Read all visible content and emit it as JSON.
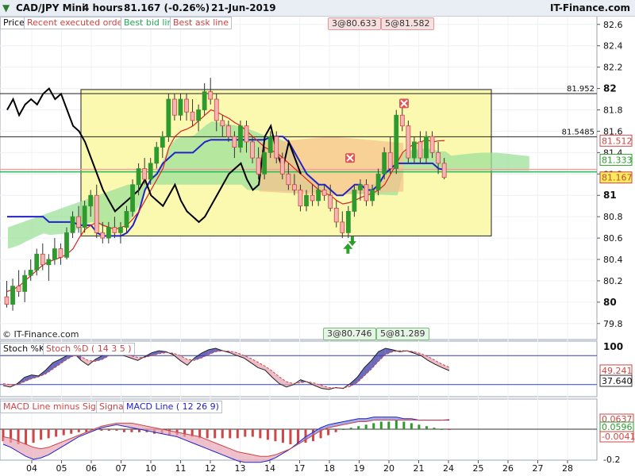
{
  "header": {
    "symbol": "CAD/JPY Mini",
    "timeframe": "4 hours",
    "price_change": "81.167 (-0.26%)",
    "date": "21-Jun-2019",
    "brand": "IT-Finance.com"
  },
  "legend": {
    "price": "Price",
    "recent": "Recent executed orders",
    "bid": "Best bid line",
    "ask": "Best ask line",
    "stoch_k": "Stoch %K",
    "stoch_d": "Stoch %D ( 14 3 5 )",
    "macd_hist": "MACD Line minus Signal",
    "macd_signal": "Signal",
    "macd_line": "MACD Line ( 12 26 9)"
  },
  "orders": {
    "top_a": "3@80.633",
    "top_b": "5@81.582",
    "bot_a": "3@80.746",
    "bot_b": "5@81.289"
  },
  "copyright": "© IT-Finance.com",
  "colors": {
    "up": "#2e9a2e",
    "down": "#d04545",
    "kijun": "#2222cc",
    "tenkan": "#dd2222",
    "chikou": "#000000",
    "cloud_bull": "#9ee09a",
    "cloud_bear": "#f6c38e",
    "rect_fill": "#fbf9b0",
    "bid": "#22bb55",
    "ask": "#f2a0a0"
  },
  "chart_data": [
    {
      "type": "candlestick",
      "title": "CAD/JPY Mini 4 hours",
      "x_tick_labels": [
        "04",
        "05",
        "06",
        "07",
        "10",
        "11",
        "12",
        "13",
        "14",
        "17",
        "18",
        "19",
        "20",
        "21",
        "24",
        "25",
        "26",
        "27",
        "28"
      ],
      "y_ticks": [
        79.8,
        80,
        80.2,
        80.4,
        80.6,
        80.8,
        81,
        81.2,
        81.4,
        81.6,
        81.8,
        82,
        82.2,
        82.4,
        82.6
      ],
      "y_tick_labels": [
        "79.8",
        "80",
        "80.2",
        "80.4",
        "80.6",
        "80.8",
        "81",
        "81.2",
        "81.4",
        "81.6",
        "81.8",
        "82",
        "82.2",
        "82.4",
        "82.6"
      ],
      "ylim": [
        79.65,
        82.68
      ],
      "levels": [
        {
          "label": "81.952",
          "value": 81.952
        },
        {
          "label": "81.5485",
          "value": 81.5485
        }
      ],
      "price_labels": [
        {
          "label": "81.512",
          "value": 81.512,
          "color": "#d04545"
        },
        {
          "label": "81.333",
          "value": 81.333,
          "color": "#2e9a2e"
        },
        {
          "label": "81.167",
          "value": 81.167,
          "color": "#d04545",
          "bg": "#f7ec5a"
        }
      ],
      "ohlc": [
        [
          80.05,
          80.2,
          79.95,
          79.98
        ],
        [
          79.98,
          80.22,
          79.92,
          80.15
        ],
        [
          80.15,
          80.3,
          80.05,
          80.1
        ],
        [
          80.1,
          80.3,
          80.0,
          80.25
        ],
        [
          80.25,
          80.4,
          80.2,
          80.3
        ],
        [
          80.3,
          80.5,
          80.25,
          80.45
        ],
        [
          80.45,
          80.55,
          80.3,
          80.35
        ],
        [
          80.35,
          80.45,
          80.2,
          80.4
        ],
        [
          80.4,
          80.6,
          80.35,
          80.5
        ],
        [
          80.5,
          80.55,
          80.35,
          80.42
        ],
        [
          80.42,
          80.7,
          80.4,
          80.65
        ],
        [
          80.65,
          80.85,
          80.6,
          80.8
        ],
        [
          80.8,
          80.9,
          80.65,
          80.7
        ],
        [
          80.7,
          80.95,
          80.65,
          80.9
        ],
        [
          80.9,
          81.05,
          80.8,
          81.0
        ],
        [
          81.0,
          81.1,
          80.6,
          80.65
        ],
        [
          80.65,
          80.75,
          80.55,
          80.6
        ],
        [
          80.6,
          80.75,
          80.55,
          80.7
        ],
        [
          80.7,
          80.8,
          80.6,
          80.65
        ],
        [
          80.65,
          80.75,
          80.55,
          80.7
        ],
        [
          80.7,
          80.9,
          80.65,
          80.85
        ],
        [
          80.85,
          81.15,
          80.8,
          81.1
        ],
        [
          81.1,
          81.3,
          81.0,
          81.25
        ],
        [
          81.25,
          81.35,
          81.1,
          81.15
        ],
        [
          81.15,
          81.35,
          81.1,
          81.3
        ],
        [
          81.3,
          81.5,
          81.25,
          81.45
        ],
        [
          81.45,
          81.6,
          81.35,
          81.55
        ],
        [
          81.55,
          81.95,
          81.5,
          81.9
        ],
        [
          81.9,
          81.95,
          81.7,
          81.75
        ],
        [
          81.75,
          81.95,
          81.7,
          81.9
        ],
        [
          81.9,
          81.95,
          81.7,
          81.78
        ],
        [
          81.78,
          81.9,
          81.65,
          81.7
        ],
        [
          81.7,
          81.85,
          81.6,
          81.8
        ],
        [
          81.8,
          82.05,
          81.75,
          81.97
        ],
        [
          81.97,
          82.1,
          81.85,
          81.9
        ],
        [
          81.9,
          81.95,
          81.6,
          81.7
        ],
        [
          81.7,
          81.75,
          81.55,
          81.65
        ],
        [
          81.65,
          81.7,
          81.5,
          81.55
        ],
        [
          81.55,
          81.6,
          81.35,
          81.45
        ],
        [
          81.45,
          81.7,
          81.4,
          81.65
        ],
        [
          81.65,
          81.7,
          81.4,
          81.5
        ],
        [
          81.5,
          81.55,
          81.3,
          81.35
        ],
        [
          81.35,
          81.45,
          81.15,
          81.2
        ],
        [
          81.2,
          81.45,
          81.15,
          81.4
        ],
        [
          81.4,
          81.6,
          81.35,
          81.55
        ],
        [
          81.55,
          81.6,
          81.3,
          81.35
        ],
        [
          81.35,
          81.4,
          81.15,
          81.2
        ],
        [
          81.2,
          81.3,
          81.05,
          81.1
        ],
        [
          81.1,
          81.2,
          81.0,
          81.05
        ],
        [
          81.05,
          81.1,
          80.85,
          80.9
        ],
        [
          80.9,
          81.05,
          80.85,
          81.0
        ],
        [
          81.0,
          81.1,
          80.9,
          80.95
        ],
        [
          80.95,
          81.1,
          80.9,
          81.05
        ],
        [
          81.05,
          81.1,
          80.95,
          81.0
        ],
        [
          81.0,
          81.1,
          80.85,
          80.88
        ],
        [
          80.88,
          80.95,
          80.7,
          80.75
        ],
        [
          80.75,
          80.85,
          80.6,
          80.65
        ],
        [
          80.65,
          80.9,
          80.6,
          80.85
        ],
        [
          80.85,
          81.1,
          80.8,
          81.05
        ],
        [
          81.05,
          81.15,
          80.95,
          81.1
        ],
        [
          81.1,
          81.15,
          80.9,
          80.95
        ],
        [
          80.95,
          81.1,
          80.9,
          81.05
        ],
        [
          81.05,
          81.25,
          81.0,
          81.2
        ],
        [
          81.2,
          81.45,
          81.15,
          81.4
        ],
        [
          81.4,
          81.55,
          81.2,
          81.25
        ],
        [
          81.25,
          81.8,
          81.2,
          81.75
        ],
        [
          81.75,
          81.85,
          81.6,
          81.65
        ],
        [
          81.65,
          81.7,
          81.3,
          81.35
        ],
        [
          81.35,
          81.55,
          81.3,
          81.5
        ],
        [
          81.5,
          81.6,
          81.3,
          81.35
        ],
        [
          81.35,
          81.6,
          81.3,
          81.55
        ],
        [
          81.55,
          81.6,
          81.35,
          81.4
        ],
        [
          81.4,
          81.5,
          81.2,
          81.3
        ],
        [
          81.3,
          81.35,
          81.15,
          81.167
        ]
      ],
      "tenkan_sen": [
        80.1,
        80.12,
        80.15,
        80.2,
        80.25,
        80.3,
        80.35,
        80.38,
        80.4,
        80.42,
        80.45,
        80.5,
        80.6,
        80.68,
        80.72,
        80.75,
        80.72,
        80.7,
        80.68,
        80.7,
        80.72,
        80.78,
        80.85,
        80.95,
        81.05,
        81.15,
        81.25,
        81.45,
        81.55,
        81.6,
        81.62,
        81.65,
        81.7,
        81.75,
        81.8,
        81.78,
        81.75,
        81.72,
        81.68,
        81.65,
        81.6,
        81.55,
        81.5,
        81.45,
        81.42,
        81.4,
        81.35,
        81.3,
        81.25,
        81.2,
        81.15,
        81.1,
        81.05,
        81.02,
        81.0,
        80.95,
        80.92,
        80.93,
        80.95,
        80.98,
        81.0,
        81.02,
        81.05,
        81.1,
        81.2,
        81.3,
        81.4,
        81.45,
        81.48,
        81.5,
        81.52,
        81.5,
        81.51,
        81.512
      ],
      "kijun_sen": [
        80.8,
        80.8,
        80.8,
        80.8,
        80.8,
        80.8,
        80.8,
        80.75,
        80.75,
        80.75,
        80.75,
        80.75,
        80.72,
        80.72,
        80.72,
        80.65,
        80.62,
        80.62,
        80.62,
        80.62,
        80.65,
        80.72,
        80.85,
        81.05,
        81.15,
        81.2,
        81.3,
        81.35,
        81.4,
        81.4,
        81.4,
        81.4,
        81.45,
        81.5,
        81.52,
        81.52,
        81.52,
        81.52,
        81.52,
        81.52,
        81.52,
        81.52,
        81.52,
        81.52,
        81.55,
        81.55,
        81.55,
        81.5,
        81.4,
        81.3,
        81.2,
        81.15,
        81.1,
        81.1,
        81.05,
        81.0,
        81.0,
        81.05,
        81.1,
        81.1,
        81.05,
        81.05,
        81.1,
        81.2,
        81.25,
        81.3,
        81.3,
        81.3,
        81.3,
        81.3,
        81.3,
        81.3,
        81.25,
        81.24
      ],
      "chikou_span": [
        81.8,
        81.9,
        81.75,
        81.85,
        81.9,
        81.85,
        81.95,
        82.0,
        81.9,
        81.95,
        81.8,
        81.65,
        81.6,
        81.5,
        81.35,
        81.2,
        81.05,
        80.95,
        80.85,
        80.9,
        80.95,
        81.0,
        81.05,
        81.15,
        81.0,
        80.95,
        80.9,
        81.0,
        81.1,
        80.95,
        80.85,
        80.8,
        80.75,
        80.8,
        80.9,
        81.0,
        81.1,
        81.2,
        81.25,
        81.3,
        81.15,
        81.05,
        81.1,
        81.55,
        81.65,
        81.4,
        81.25,
        81.5,
        81.35,
        81.2
      ]
    },
    {
      "type": "line",
      "title": "Stoch %K / Stoch %D ( 14 3 5 )",
      "y_tick_labels": [
        "100"
      ],
      "ylim": [
        0,
        100
      ],
      "levels": [
        20,
        80
      ],
      "value_labels": [
        "49.241",
        "37.640"
      ],
      "series": [
        {
          "name": "Stoch %K",
          "values": [
            18,
            15,
            22,
            35,
            40,
            38,
            50,
            65,
            72,
            80,
            85,
            70,
            60,
            72,
            80,
            88,
            85,
            80,
            75,
            70,
            78,
            86,
            90,
            88,
            82,
            70,
            60,
            75,
            85,
            92,
            95,
            90,
            86,
            80,
            75,
            65,
            55,
            50,
            35,
            22,
            15,
            20,
            30,
            25,
            18,
            12,
            10,
            14,
            12,
            22,
            35,
            55,
            70,
            88,
            95,
            92,
            88,
            90,
            85,
            80,
            70,
            62,
            55,
            49
          ]
        },
        {
          "name": "Stoch %D ( 14 3 5 )",
          "values": [
            22,
            20,
            20,
            26,
            32,
            36,
            42,
            52,
            62,
            72,
            80,
            78,
            70,
            68,
            72,
            80,
            84,
            83,
            80,
            76,
            76,
            80,
            84,
            86,
            85,
            80,
            72,
            70,
            75,
            82,
            88,
            90,
            89,
            86,
            80,
            74,
            66,
            58,
            48,
            36,
            26,
            22,
            24,
            26,
            23,
            18,
            14,
            13,
            13,
            16,
            24,
            38,
            52,
            68,
            82,
            88,
            90,
            90,
            88,
            84,
            78,
            70,
            62,
            56
          ]
        }
      ]
    },
    {
      "type": "bar",
      "title": "MACD Line ( 12 26 9)",
      "y_tick_labels": [
        "-0.2"
      ],
      "value_labels": [
        "0.0637",
        "0.0596",
        "-0.0041"
      ],
      "series": [
        {
          "name": "MACD Line minus Signal",
          "values": [
            -0.08,
            -0.09,
            -0.1,
            -0.1,
            -0.09,
            -0.07,
            -0.06,
            -0.05,
            -0.04,
            -0.03,
            -0.02,
            -0.02,
            -0.01,
            -0.01,
            -0.01,
            -0.01,
            -0.02,
            -0.02,
            -0.02,
            -0.02,
            -0.03,
            -0.03,
            -0.04,
            -0.04,
            -0.05,
            -0.05,
            -0.06,
            -0.06,
            -0.06,
            -0.06,
            -0.06,
            -0.06,
            -0.05,
            -0.05,
            -0.06,
            -0.07,
            -0.08,
            -0.09,
            -0.1,
            -0.1,
            -0.09,
            -0.08,
            -0.06,
            -0.04,
            -0.02,
            0.0,
            0.01,
            0.02,
            0.03,
            0.04,
            0.05,
            0.05,
            0.06,
            0.05,
            0.04,
            0.03,
            0.02,
            0.01,
            0.0,
            -0.004
          ]
        },
        {
          "name": "Signal",
          "values": [
            -0.05,
            -0.06,
            -0.08,
            -0.1,
            -0.12,
            -0.13,
            -0.12,
            -0.1,
            -0.08,
            -0.06,
            -0.04,
            -0.02,
            0.0,
            0.02,
            0.03,
            0.04,
            0.04,
            0.04,
            0.03,
            0.02,
            0.01,
            0.0,
            -0.01,
            -0.02,
            -0.03,
            -0.04,
            -0.05,
            -0.07,
            -0.09,
            -0.11,
            -0.13,
            -0.15,
            -0.16,
            -0.17,
            -0.18,
            -0.18,
            -0.17,
            -0.15,
            -0.13,
            -0.1,
            -0.07,
            -0.04,
            -0.01,
            0.01,
            0.02,
            0.03,
            0.04,
            0.05,
            0.05,
            0.06,
            0.06,
            0.06,
            0.06,
            0.06,
            0.06,
            0.06,
            0.06,
            0.06,
            0.06,
            0.0637
          ]
        },
        {
          "name": "MACD Line ( 12 26 9)",
          "values": [
            -0.1,
            -0.12,
            -0.15,
            -0.18,
            -0.2,
            -0.19,
            -0.17,
            -0.14,
            -0.11,
            -0.08,
            -0.05,
            -0.03,
            -0.01,
            0.01,
            0.02,
            0.03,
            0.02,
            0.01,
            0.0,
            -0.01,
            -0.02,
            -0.03,
            -0.04,
            -0.05,
            -0.07,
            -0.09,
            -0.11,
            -0.13,
            -0.15,
            -0.17,
            -0.19,
            -0.21,
            -0.22,
            -0.22,
            -0.22,
            -0.21,
            -0.19,
            -0.16,
            -0.13,
            -0.09,
            -0.05,
            -0.02,
            0.01,
            0.03,
            0.04,
            0.05,
            0.06,
            0.07,
            0.07,
            0.08,
            0.08,
            0.08,
            0.08,
            0.07,
            0.07,
            0.06,
            0.06,
            0.06,
            0.06,
            0.0596
          ]
        }
      ]
    }
  ]
}
